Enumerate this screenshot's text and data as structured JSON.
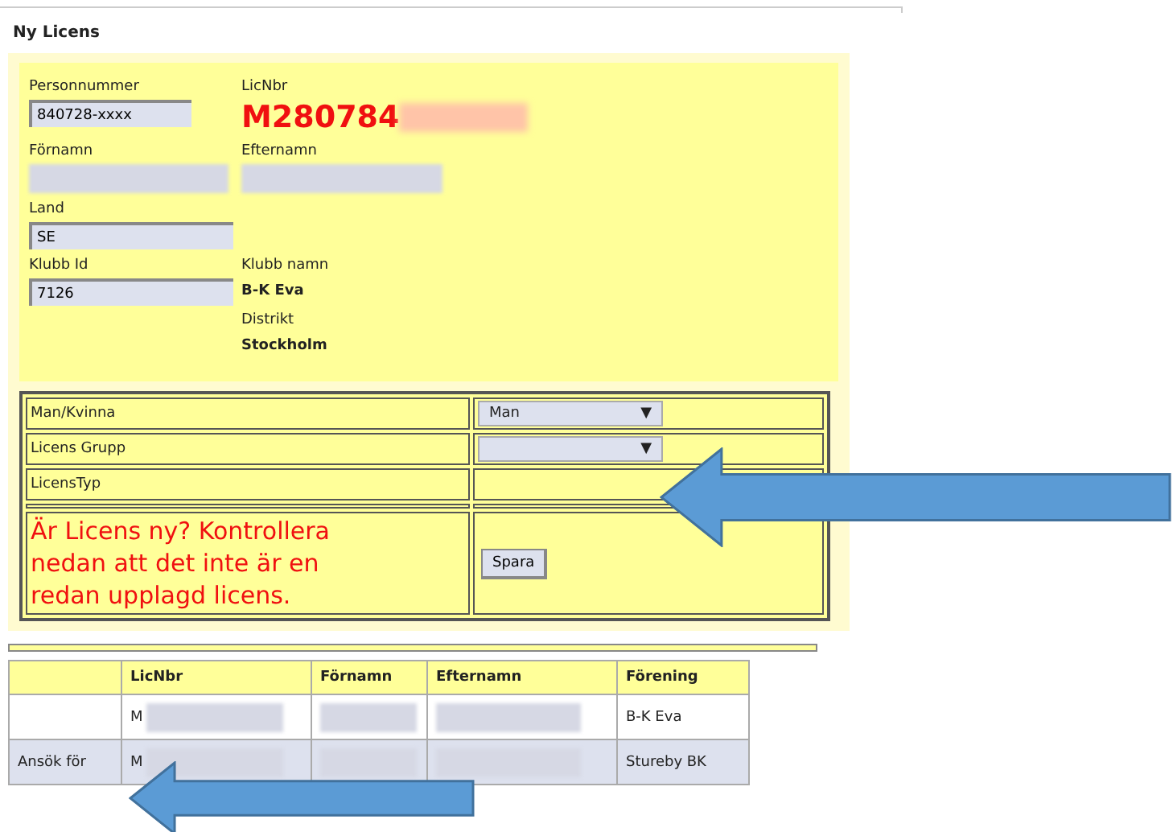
{
  "page_title": "Ny Licens",
  "person": {
    "personnummer_label": "Personnummer",
    "personnummer": "840728-xxxx",
    "licnbr_label": "LicNbr",
    "licnbr": "M280784",
    "fornamn_label": "Förnamn",
    "efternamn_label": "Efternamn",
    "land_label": "Land",
    "land": "SE",
    "klubb_id_label": "Klubb Id",
    "klubb_id": "7126",
    "klubb_namn_label": "Klubb namn",
    "klubb_namn": "B-K Eva",
    "distrikt_label": "Distrikt",
    "distrikt": "Stockholm"
  },
  "form_rows": [
    {
      "kind": "select",
      "label": "Man/Kvinna",
      "value": "Man",
      "caret": "▼"
    },
    {
      "kind": "select",
      "label": "Licens Grupp",
      "value": "",
      "caret": "▼"
    },
    {
      "kind": "empty",
      "label": "LicensTyp"
    }
  ],
  "warning": "Är Licens ny? Kontrollera nedan att det inte är en redan upplagd licens.",
  "save_button": "Spara",
  "results": {
    "columns": [
      "",
      "LicNbr",
      "Förnamn",
      "Efternamn",
      "Förening"
    ],
    "rows": [
      {
        "action": "",
        "licnbr": "M",
        "forening": "B-K Eva",
        "selected": false
      },
      {
        "action": "Ansök för",
        "licnbr": "M",
        "forening": "Stureby BK",
        "selected": true
      }
    ]
  }
}
